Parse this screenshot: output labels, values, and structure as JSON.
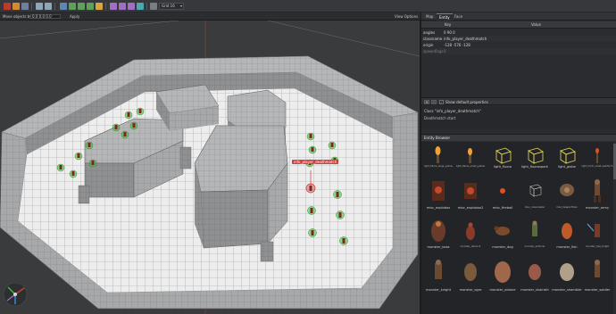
{
  "toolbar": {
    "icons": [
      "new-map-icon",
      "open-icon",
      "save-icon",
      "undo-icon",
      "redo-icon",
      "select-icon",
      "translate-icon",
      "rotate-icon",
      "scale-icon",
      "clip-icon",
      "vertex-icon",
      "edge-icon",
      "face-icon",
      "csg-icon",
      "snap-icon",
      "grid-icon",
      "texture-lock-icon",
      "uv-lock-icon",
      "compile-icon",
      "launch-icon",
      "settings-icon",
      "help-icon"
    ],
    "grid_select": "Grid 16"
  },
  "subbar": {
    "move_label": "Move objects by",
    "move_value": "0.0 0.0 0.0",
    "apply_label": "Apply",
    "view_options": "View Options"
  },
  "viewport": {
    "selection_label": "info_player_deathmatch"
  },
  "panel": {
    "tabs": [
      "Map",
      "Entity",
      "Face"
    ],
    "active_tab": "Entity",
    "columns": {
      "key": "Key",
      "value": "Value"
    },
    "properties": [
      {
        "key": "angles",
        "value": "0 90 0"
      },
      {
        "key": "classname",
        "value": "info_player_deathmatch"
      },
      {
        "key": "origin",
        "value": "-128 -576 -128"
      },
      {
        "key": "spawnflags",
        "value": "0"
      }
    ],
    "add_button": "+",
    "remove_button": "-",
    "show_defaults_checked": "✓",
    "show_defaults_label": "Show default properties",
    "class_description": "Class \"info_player_deathmatch\"",
    "class_detail": "Deathmatch start",
    "entity_browser_title": "Entity Browser"
  },
  "entity_browser": {
    "row1": [
      "light_flame_large_yellow",
      "light_flame_small_yellow",
      "light_fluoro",
      "light_fluorospark",
      "light_globe",
      "light_torch_small_walltorch"
    ],
    "row2": [
      "misc_explobox",
      "misc_explobox2",
      "misc_fireball",
      "misc_noisemaker",
      "misc_teleporttrain",
      "monster_army"
    ],
    "row3": [
      "monster_boss",
      "monster_demon1",
      "monster_dog",
      "monster_enforcer",
      "monster_fish",
      "monster_hell_knight"
    ],
    "row4": [
      "monster_knight",
      "monster_ogre",
      "monster_oldone",
      "monster_shalrath",
      "monster_shambler",
      "monster_soldier"
    ]
  },
  "colors": {
    "accent": "#3b8fd9",
    "selection": "#d13b3b",
    "entity_marker": "#3fbf3f"
  }
}
